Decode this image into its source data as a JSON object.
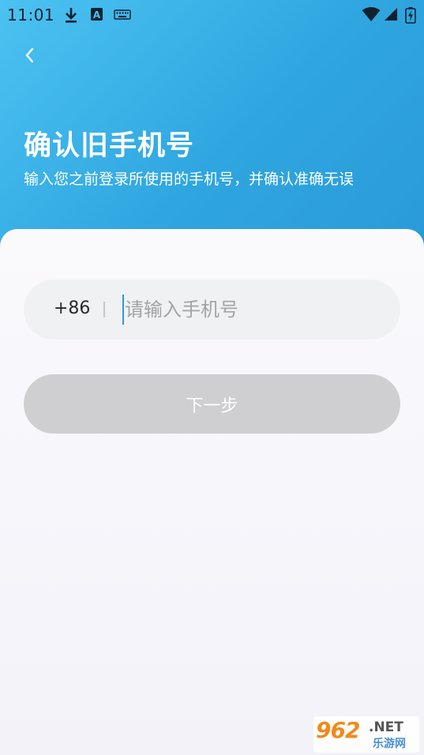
{
  "status_bar": {
    "time": "11:01",
    "icons": [
      "download-icon",
      "a-icon",
      "keyboard-icon",
      "wifi-icon",
      "signal-icon",
      "battery-charging-icon"
    ]
  },
  "header": {
    "back_icon": "chevron-left-icon",
    "title": "确认旧手机号",
    "subtitle": "输入您之前登录所使用的手机号，并确认准确无误"
  },
  "form": {
    "country_code": "+86",
    "phone_placeholder": "请输入手机号",
    "phone_value": "",
    "next_label": "下一步"
  },
  "watermark": {
    "number": "962",
    "suffix": ".NET",
    "site": "乐游网"
  },
  "colors": {
    "header_start": "#4cc2f2",
    "header_end": "#2a9ad8",
    "button_disabled": "#cfcfd1",
    "input_bg": "#f0f1f3"
  }
}
